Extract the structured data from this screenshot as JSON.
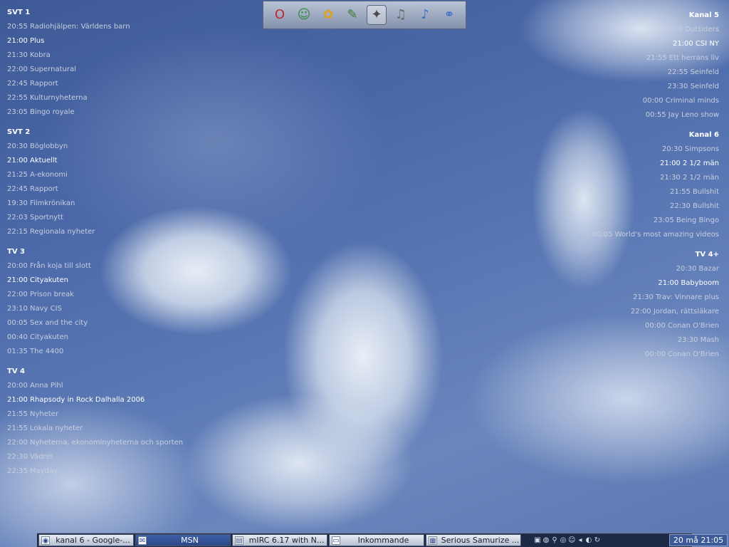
{
  "left_guide": [
    {
      "name": "SVT 1",
      "shows": [
        {
          "text": "20:55 Radiohjälpen: Världens barn",
          "current": false
        },
        {
          "text": "21:00 Plus",
          "current": true
        },
        {
          "text": "21:30 Kobra",
          "current": false
        },
        {
          "text": "22:00 Supernatural",
          "current": false
        },
        {
          "text": "22:45 Rapport",
          "current": false
        },
        {
          "text": "22:55 Kulturnyheterna",
          "current": false
        },
        {
          "text": "23:05 Bingo royale",
          "current": false
        }
      ]
    },
    {
      "name": "SVT 2",
      "shows": [
        {
          "text": "20:30 Böglobbyn",
          "current": false
        },
        {
          "text": "21:00 Aktuellt",
          "current": true
        },
        {
          "text": "21:25 A-ekonomi",
          "current": false
        },
        {
          "text": "22:45 Rapport",
          "current": false
        },
        {
          "text": "19:30 Filmkrönikan",
          "current": false
        },
        {
          "text": "22:03 Sportnytt",
          "current": false
        },
        {
          "text": "22:15 Regionala nyheter",
          "current": false
        }
      ]
    },
    {
      "name": "TV 3",
      "shows": [
        {
          "text": "20:00 Från koja till slott",
          "current": false
        },
        {
          "text": "21:00 Cityakuten",
          "current": true
        },
        {
          "text": "22:00 Prison break",
          "current": false
        },
        {
          "text": "23:10 Navy CIS",
          "current": false
        },
        {
          "text": "00:05 Sex and the city",
          "current": false
        },
        {
          "text": "00:40 Cityakuten",
          "current": false
        },
        {
          "text": "01:35 The 4400",
          "current": false
        }
      ]
    },
    {
      "name": "TV 4",
      "shows": [
        {
          "text": "20:00 Anna Pihl",
          "current": false
        },
        {
          "text": "21:00 Rhapsody in Rock Dalhalla 2006",
          "current": true
        },
        {
          "text": "21:55 Nyheter",
          "current": false
        },
        {
          "text": "21:55 Lokala nyheter",
          "current": false
        },
        {
          "text": "22:00 Nyheterna, ekonominyheterna och sporten",
          "current": false
        },
        {
          "text": "22:30 Vädret",
          "current": false
        },
        {
          "text": "22:35 Mayday",
          "current": false
        }
      ]
    }
  ],
  "right_guide": [
    {
      "name": "Kanal 5",
      "shows": [
        {
          "text": "20:00 Outsiders",
          "current": false
        },
        {
          "text": "21:00 CSI NY",
          "current": true
        },
        {
          "text": "21:55 Ett herrans liv",
          "current": false
        },
        {
          "text": "22:55 Seinfeld",
          "current": false
        },
        {
          "text": "23:30 Seinfeld",
          "current": false
        },
        {
          "text": "00:00 Criminal minds",
          "current": false
        },
        {
          "text": "00:55 Jay Leno show",
          "current": false
        }
      ]
    },
    {
      "name": "Kanal 6",
      "shows": [
        {
          "text": "20:30 Simpsons",
          "current": false
        },
        {
          "text": "21:00 2 1/2 män",
          "current": true
        },
        {
          "text": "21:30 2 1/2 män",
          "current": false
        },
        {
          "text": "21:55 Bullshit",
          "current": false
        },
        {
          "text": "22:30 Bullshit",
          "current": false
        },
        {
          "text": "23:05 Being Bingo",
          "current": false
        },
        {
          "text": "00:05 World's most amazing videos",
          "current": false
        }
      ]
    },
    {
      "name": "TV 4+",
      "shows": [
        {
          "text": "20:30 Bazar",
          "current": false
        },
        {
          "text": "21:00 Babyboom",
          "current": true
        },
        {
          "text": "21:30 Trav: Vinnare plus",
          "current": false
        },
        {
          "text": "22:00 Jordan, rättsläkare",
          "current": false
        },
        {
          "text": "00:00 Conan O'Brien",
          "current": false
        },
        {
          "text": "23:30 Mash",
          "current": false
        },
        {
          "text": "00:00 Conan O'Brien",
          "current": false
        }
      ]
    }
  ],
  "quicklaunch": [
    {
      "icon": "opera-icon",
      "glyph": "O",
      "color": "#c0282d"
    },
    {
      "icon": "msn-icon",
      "glyph": "☺",
      "color": "#2e8b3e"
    },
    {
      "icon": "fl-studio-icon",
      "glyph": "✿",
      "color": "#e0a020"
    },
    {
      "icon": "paint-brush-icon",
      "glyph": "✎",
      "color": "#3a7a2e"
    },
    {
      "icon": "foobar-icon",
      "glyph": "✦",
      "color": "#4a4a4a"
    },
    {
      "icon": "rhythm-icon",
      "glyph": "♫",
      "color": "#6a6a6a"
    },
    {
      "icon": "itunes-icon",
      "glyph": "♪",
      "color": "#3a6ec8"
    },
    {
      "icon": "link-icon",
      "glyph": "⚭",
      "color": "#3a6ec8"
    }
  ],
  "taskbar": {
    "tasks": [
      {
        "label": "kanal 6 - Google-...",
        "icon": "browser-icon",
        "glyph": "◉",
        "active": false
      },
      {
        "label": "MSN",
        "icon": "msn-task-icon",
        "glyph": "✉",
        "active": true
      },
      {
        "label": "mIRC 6.17 with N...",
        "icon": "mirc-icon",
        "glyph": "▤",
        "active": false
      },
      {
        "label": "Inkommande",
        "icon": "folder-icon",
        "glyph": "▭",
        "active": false
      },
      {
        "label": "Serious Samurize ...",
        "icon": "samurize-icon",
        "glyph": "▦",
        "active": false
      }
    ],
    "tray_icons": [
      {
        "icon": "printer-icon",
        "glyph": "▣"
      },
      {
        "icon": "network-icon",
        "glyph": "◍"
      },
      {
        "icon": "usb-icon",
        "glyph": "⚲"
      },
      {
        "icon": "antivirus-icon",
        "glyph": "◎"
      },
      {
        "icon": "messenger-icon",
        "glyph": "☺"
      },
      {
        "icon": "volume-icon",
        "glyph": "◂"
      },
      {
        "icon": "shield-icon",
        "glyph": "◐"
      },
      {
        "icon": "update-icon",
        "glyph": "↻"
      }
    ],
    "clock": "20 må 21:05"
  }
}
